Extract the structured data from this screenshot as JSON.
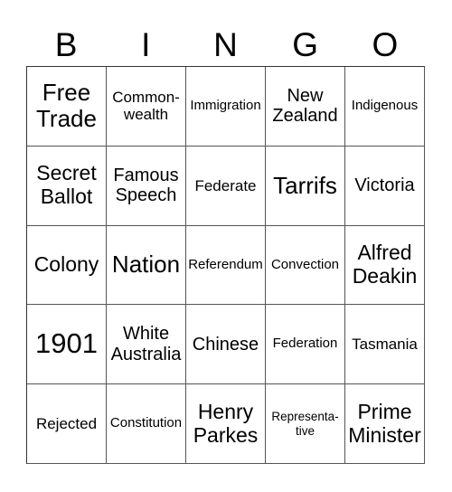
{
  "header": {
    "letters": [
      "B",
      "I",
      "N",
      "G",
      "O"
    ]
  },
  "card": {
    "rows": [
      [
        {
          "text": "Free Trade",
          "size": "s-l"
        },
        {
          "text": "Common-wealth",
          "size": "s-s"
        },
        {
          "text": "Immigration",
          "size": "s-xs"
        },
        {
          "text": "New Zealand",
          "size": "s-m"
        },
        {
          "text": "Indigenous",
          "size": "s-xs"
        }
      ],
      [
        {
          "text": "Secret Ballot",
          "size": "s-ml"
        },
        {
          "text": "Famous Speech",
          "size": "s-m"
        },
        {
          "text": "Federate",
          "size": "s-s"
        },
        {
          "text": "Tarrifs",
          "size": "s-l"
        },
        {
          "text": "Victoria",
          "size": "s-m"
        }
      ],
      [
        {
          "text": "Colony",
          "size": "s-ml"
        },
        {
          "text": "Nation",
          "size": "s-l"
        },
        {
          "text": "Referendum",
          "size": "s-xs"
        },
        {
          "text": "Convection",
          "size": "s-xs"
        },
        {
          "text": "Alfred Deakin",
          "size": "s-ml"
        }
      ],
      [
        {
          "text": "1901",
          "size": "s-xl"
        },
        {
          "text": "White Australia",
          "size": "s-m"
        },
        {
          "text": "Chinese",
          "size": "s-m"
        },
        {
          "text": "Federation",
          "size": "s-xs"
        },
        {
          "text": "Tasmania",
          "size": "s-s"
        }
      ],
      [
        {
          "text": "Rejected",
          "size": "s-s"
        },
        {
          "text": "Constitution",
          "size": "s-xs"
        },
        {
          "text": "Henry Parkes",
          "size": "s-ml"
        },
        {
          "text": "Representa-tive",
          "size": "s-xxs"
        },
        {
          "text": "Prime Minister",
          "size": "s-ml"
        }
      ]
    ]
  }
}
